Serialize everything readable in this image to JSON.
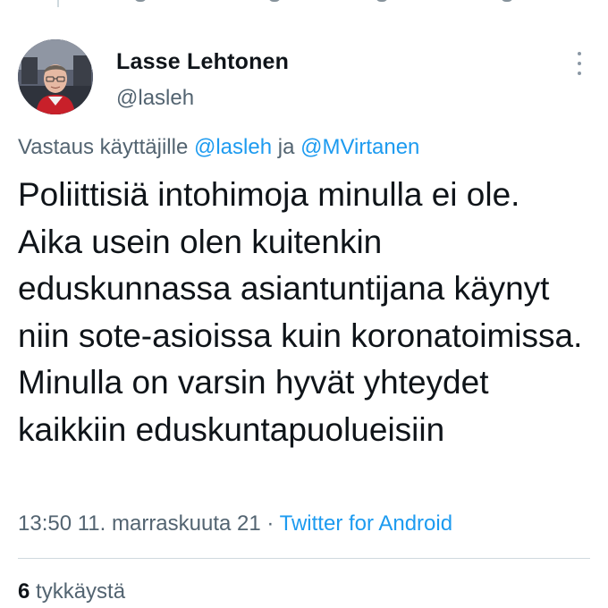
{
  "tweet": {
    "author_name": "Lasse Lehtonen",
    "author_handle": "@lasleh",
    "reply_prefix": "Vastaus käyttäjille",
    "reply_mention_1": "@lasleh",
    "reply_conjunction": "ja",
    "reply_mention_2": "@MVirtanen",
    "text": "Poliittisiä intohimoja minulla ei ole. Aika usein olen kuitenkin eduskunnassa asiantuntijana käynyt niin sote-asioissa kuin koronatoimissa. Minulla on varsin hyvät yhteydet kaikkiin eduskuntapuolueisiin",
    "time": "13:50",
    "date": "11. marraskuuta 21",
    "separator": "·",
    "source": "Twitter for Android",
    "like_count": "6",
    "like_label": "tykkäystä"
  },
  "icons": {
    "more": "more-horizontal-icon",
    "avatar": "avatar-photo"
  },
  "colors": {
    "accent": "#1d9bf0",
    "text": "#0f1419",
    "secondary": "#536471",
    "divider": "#cfd9de"
  }
}
